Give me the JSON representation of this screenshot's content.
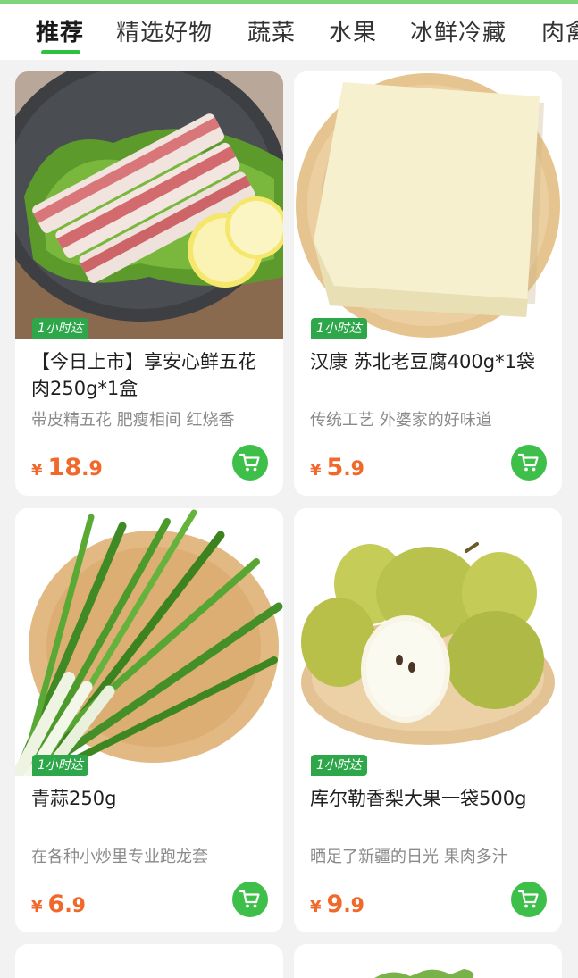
{
  "tabs": [
    {
      "label": "推荐",
      "active": true
    },
    {
      "label": "精选好物",
      "active": false
    },
    {
      "label": "蔬菜",
      "active": false
    },
    {
      "label": "水果",
      "active": false
    },
    {
      "label": "冰鲜冷藏",
      "active": false
    },
    {
      "label": "肉禽",
      "active": false
    }
  ],
  "colors": {
    "accent": "#3dbf4a",
    "price": "#f0682a",
    "badge": "#2ea74a"
  },
  "products": [
    {
      "badge": "1小时达",
      "title": "【今日上市】享安心鲜五花肉250g*1盒",
      "description": "带皮精五花 肥瘦相间 红烧香",
      "price_currency": "¥",
      "price_int": "18",
      "price_dec": ".9",
      "cart_icon": "cart-icon"
    },
    {
      "badge": "1小时达",
      "title": "汉康 苏北老豆腐400g*1袋",
      "description": "传统工艺 外婆家的好味道",
      "price_currency": "¥",
      "price_int": "5",
      "price_dec": ".9",
      "cart_icon": "cart-icon"
    },
    {
      "badge": "1小时达",
      "title": "青蒜250g",
      "description": "在各种小炒里专业跑龙套",
      "price_currency": "¥",
      "price_int": "6",
      "price_dec": ".9",
      "cart_icon": "cart-icon"
    },
    {
      "badge": "1小时达",
      "title": "库尔勒香梨大果一袋500g",
      "description": "晒足了新疆的日光 果肉多汁",
      "price_currency": "¥",
      "price_int": "9",
      "price_dec": ".9",
      "cart_icon": "cart-icon"
    }
  ]
}
